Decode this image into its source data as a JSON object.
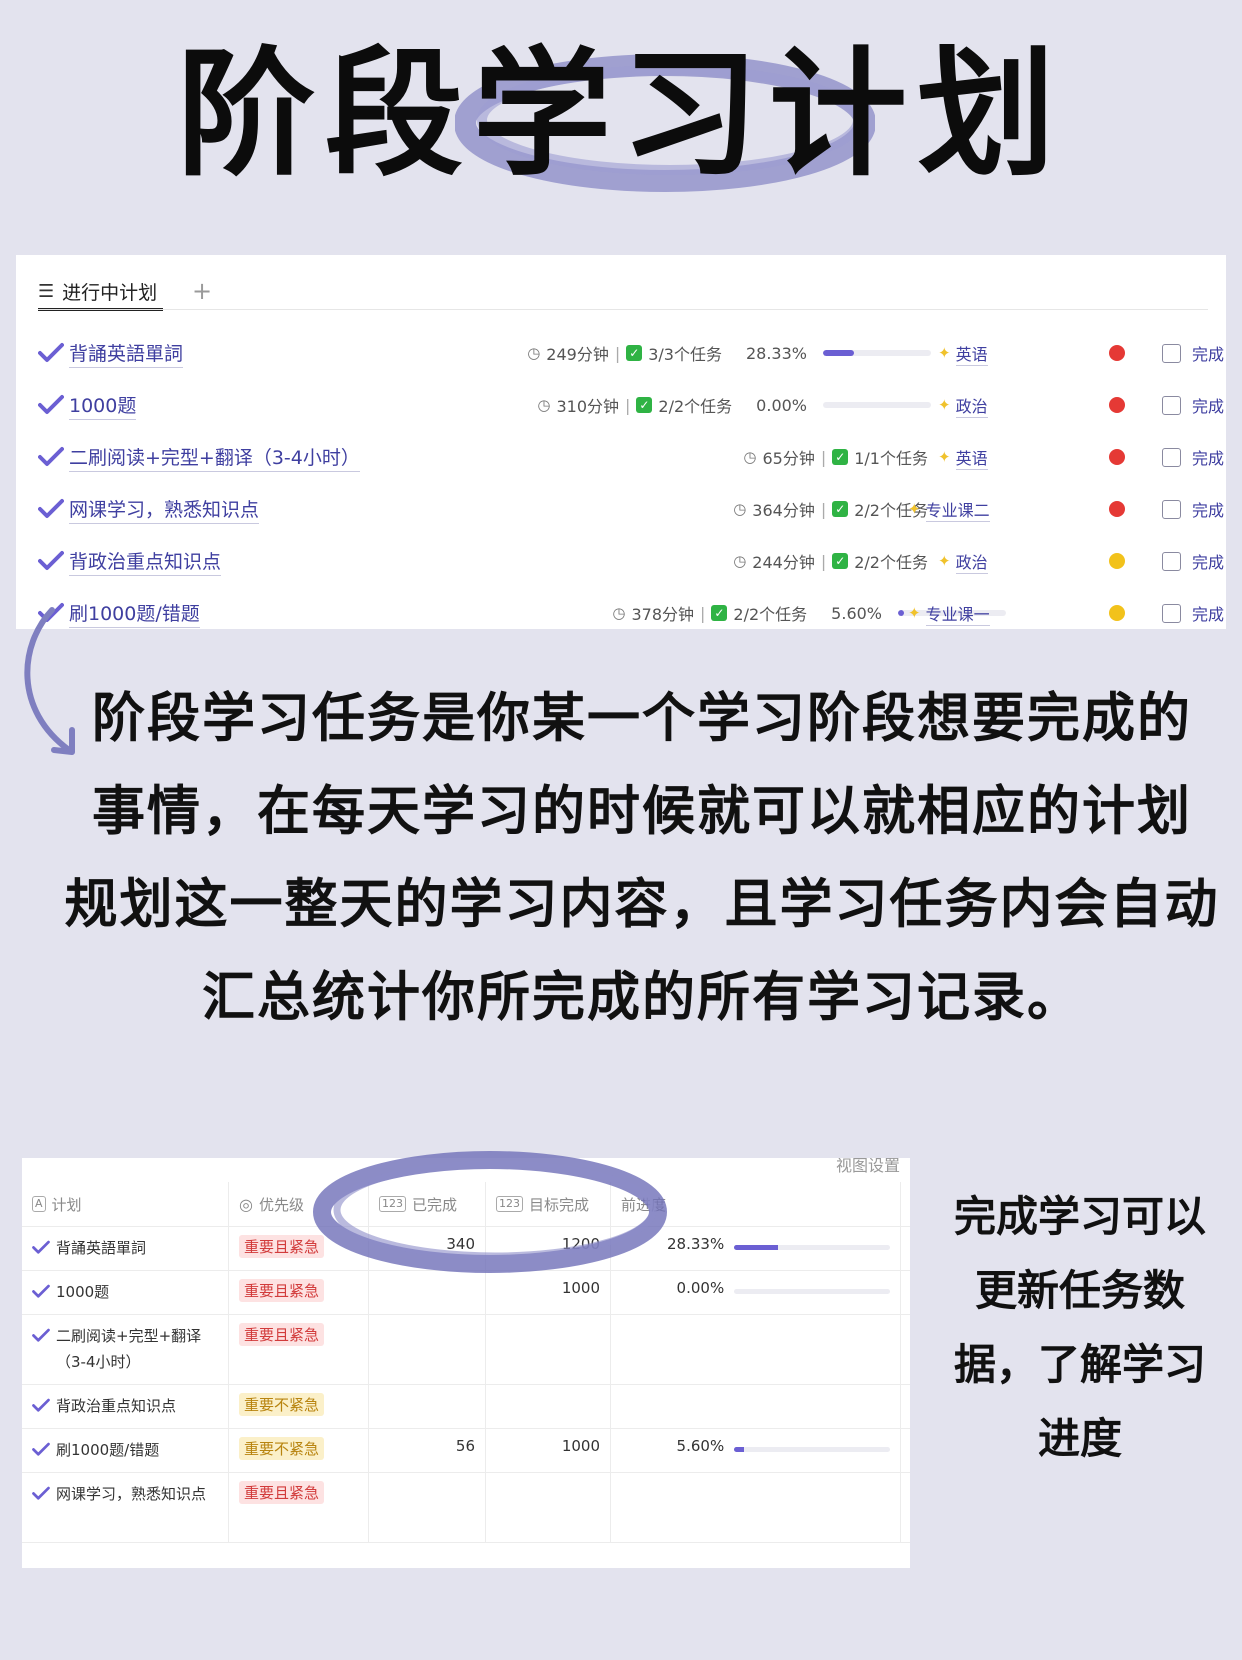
{
  "title": "阶段学习计划",
  "top_panel": {
    "view_tab_label": "进行中计划",
    "add_symbol": "+",
    "rows": [
      {
        "name": "背誦英語單詞",
        "minutes": "249分钟",
        "tasks": "3/3个任务",
        "percent": "28.33%",
        "progress": 0.2833,
        "subject": "英语",
        "status_color": "#e53935",
        "done_label": "完成"
      },
      {
        "name": "1000题",
        "minutes": "310分钟",
        "tasks": "2/2个任务",
        "percent": "0.00%",
        "progress": 0.0,
        "subject": "政治",
        "status_color": "#e53935",
        "done_label": "完成"
      },
      {
        "name": "二刷阅读+完型+翻译（3-4小时）",
        "minutes": "65分钟",
        "tasks": "1/1个任务",
        "percent": "",
        "progress": null,
        "subject": "英语",
        "status_color": "#e53935",
        "done_label": "完成"
      },
      {
        "name": "网课学习，熟悉知识点",
        "minutes": "364分钟",
        "tasks": "2/2个任务",
        "percent": "",
        "progress": null,
        "subject": "专业课二",
        "status_color": "#e53935",
        "done_label": "完成"
      },
      {
        "name": "背政治重点知识点",
        "minutes": "244分钟",
        "tasks": "2/2个任务",
        "percent": "",
        "progress": null,
        "subject": "政治",
        "status_color": "#f2c21b",
        "done_label": "完成"
      },
      {
        "name": "刷1000题/错题",
        "minutes": "378分钟",
        "tasks": "2/2个任务",
        "percent": "5.60%",
        "progress": 0.056,
        "subject": "专业课一",
        "status_color": "#f2c21b",
        "done_label": "完成"
      }
    ]
  },
  "paragraph": [
    "阶段学习任务是你某一个学习阶段想要完成的",
    "事情，在每天学习的时候就可以就相应的计划",
    "规划这一整天的学习内容，且学习任务内会自动",
    "汇总统计你所完成的所有学习记录。"
  ],
  "table": {
    "view_settings": "视图设置",
    "headers": {
      "plan": "计划",
      "priority": "优先级",
      "completed": "已完成",
      "target": "目标完成",
      "progress": "前进度"
    },
    "header_icons": {
      "plan": "A",
      "number": "123"
    },
    "rows": [
      {
        "name": "背誦英語單詞",
        "priority": "重要且紧急",
        "priority_color": "red",
        "completed": "340",
        "target": "1200",
        "percent": "28.33%",
        "progress": 0.2833
      },
      {
        "name": "1000题",
        "priority": "重要且紧急",
        "priority_color": "red",
        "completed": "",
        "target": "1000",
        "percent": "0.00%",
        "progress": 0.0
      },
      {
        "name": "二刷阅读+完型+翻译（3-4小时）",
        "priority": "重要且紧急",
        "priority_color": "red",
        "completed": "",
        "target": "",
        "percent": "",
        "progress": null
      },
      {
        "name": "背政治重点知识点",
        "priority": "重要不紧急",
        "priority_color": "yellow",
        "completed": "",
        "target": "",
        "percent": "",
        "progress": null
      },
      {
        "name": "刷1000题/错题",
        "priority": "重要不紧急",
        "priority_color": "yellow",
        "completed": "56",
        "target": "1000",
        "percent": "5.60%",
        "progress": 0.056
      },
      {
        "name": "网课学习，熟悉知识点",
        "priority": "重要且紧急",
        "priority_color": "red",
        "completed": "",
        "target": "",
        "percent": "",
        "progress": null
      }
    ]
  },
  "side_text": [
    "完成学习可以",
    "更新任务数",
    "据，了解学习",
    "进度"
  ],
  "colors": {
    "accent": "#6b5fd3",
    "brush": "#7f7fc0",
    "background": "#e3e3ee"
  }
}
